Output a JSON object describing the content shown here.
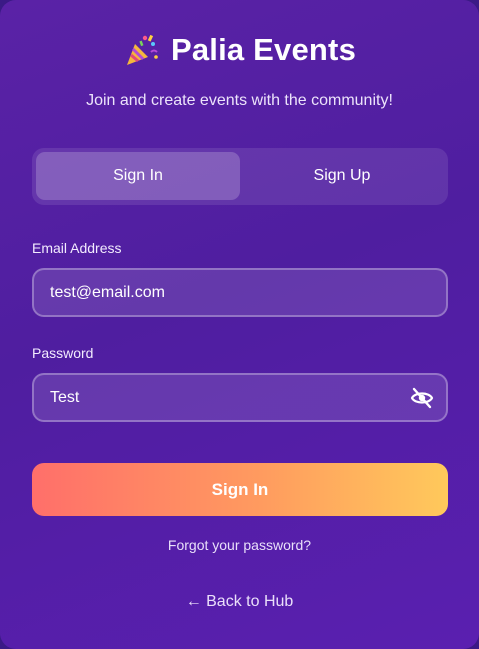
{
  "header": {
    "icon": "party-popper-icon",
    "title": "Palia Events",
    "subtitle": "Join and create events with the community!"
  },
  "tabs": [
    {
      "label": "Sign In",
      "active": true
    },
    {
      "label": "Sign Up",
      "active": false
    }
  ],
  "form": {
    "email": {
      "label": "Email Address",
      "value": "test@email.com"
    },
    "password": {
      "label": "Password",
      "value": "Test",
      "toggle_icon": "eye-off-icon"
    },
    "submit_label": "Sign In",
    "forgot_label": "Forgot your password?"
  },
  "back_link": "← Back to Hub",
  "colors": {
    "background": "#4f1ea0",
    "button_gradient_start": "#ff6f6a",
    "button_gradient_end": "#ffc95b",
    "text": "#ffffff"
  }
}
